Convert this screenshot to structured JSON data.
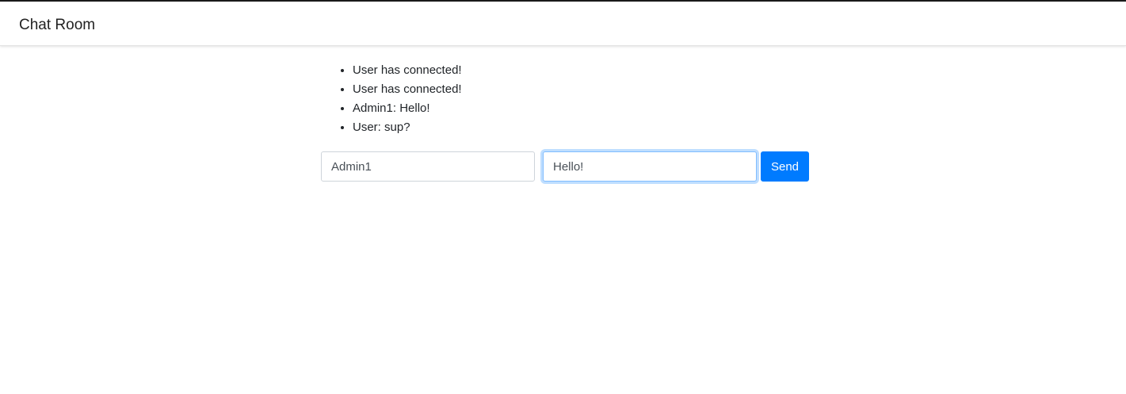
{
  "navbar": {
    "brand": "Chat Room"
  },
  "messages": [
    "User has connected!",
    "User has connected!",
    "Admin1: Hello!",
    "User: sup?"
  ],
  "form": {
    "user_value": "Admin1",
    "message_value": "Hello!",
    "send_label": "Send"
  },
  "colors": {
    "primary": "#007bff",
    "focus_border": "#80bdff"
  }
}
